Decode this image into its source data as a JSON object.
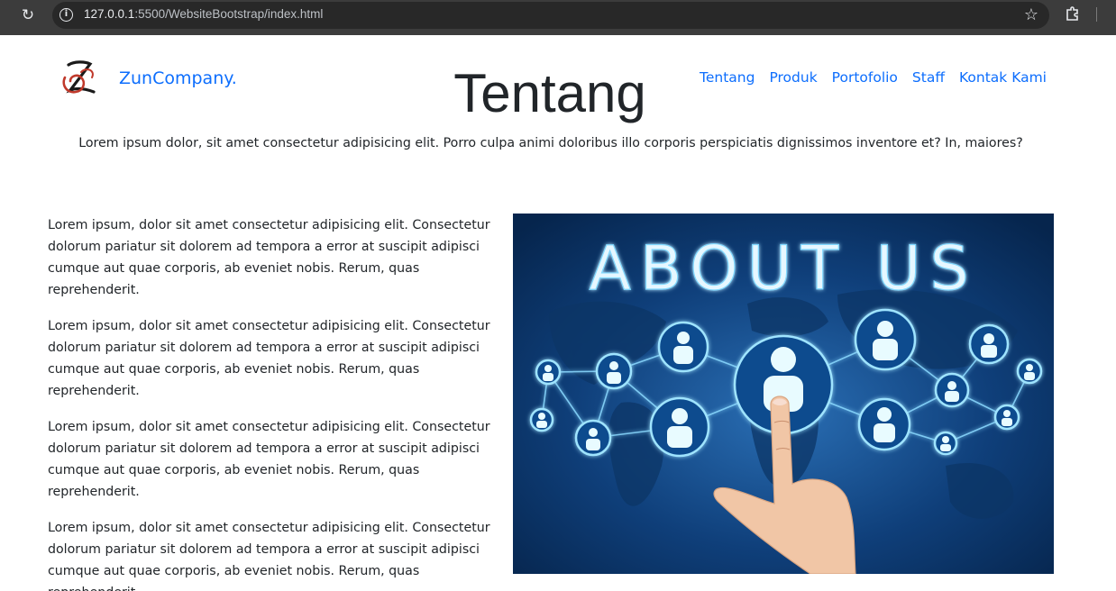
{
  "browser": {
    "url_host": "127.0.0.1",
    "url_path": ":5500/WebsiteBootstrap/index.html",
    "icons": [
      "reload-icon",
      "info-icon",
      "star-icon",
      "extensions-icon"
    ]
  },
  "navbar": {
    "brand": "ZunCompany.",
    "links": [
      "Tentang",
      "Produk",
      "Portofolio",
      "Staff",
      "Kontak Kami"
    ]
  },
  "section": {
    "title": "Tentang",
    "lead": "Lorem ipsum dolor, sit amet consectetur adipisicing elit. Porro culpa animi doloribus illo corporis perspiciatis dignissimos inventore et? In, maiores?",
    "paragraphs": [
      "Lorem ipsum, dolor sit amet consectetur adipisicing elit. Consectetur dolorum pariatur sit dolorem ad tempora a error at suscipit adipisci cumque aut quae corporis, ab eveniet nobis. Rerum, quas reprehenderit.",
      "Lorem ipsum, dolor sit amet consectetur adipisicing elit. Consectetur dolorum pariatur sit dolorem ad tempora a error at suscipit adipisci cumque aut quae corporis, ab eveniet nobis. Rerum, quas reprehenderit.",
      "Lorem ipsum, dolor sit amet consectetur adipisicing elit. Consectetur dolorum pariatur sit dolorem ad tempora a error at suscipit adipisci cumque aut quae corporis, ab eveniet nobis. Rerum, quas reprehenderit.",
      "Lorem ipsum, dolor sit amet consectetur adipisicing elit. Consectetur dolorum pariatur sit dolorem ad tempora a error at suscipit adipisci cumque aut quae corporis, ab eveniet nobis. Rerum, quas reprehenderit."
    ],
    "image_text": "ABOUT US"
  },
  "colors": {
    "link": "#0d6efd",
    "chrome_bg": "#3c3c3c",
    "image_bg_dark": "#0a2a55",
    "image_glow": "#7fd8ff"
  }
}
